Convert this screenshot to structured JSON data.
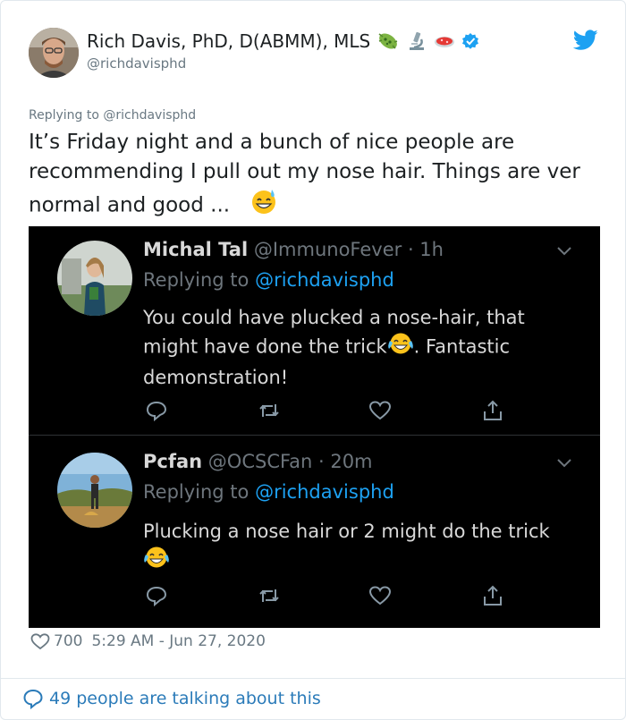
{
  "author": {
    "name": "Rich Davis, PhD, D(ABMM), MLS",
    "handle": "@richdavisphd"
  },
  "replying_to": "Replying to @richdavisphd",
  "tweet_text": "It’s Friday night and a bunch of nice people are recommending I pull out my nose hair. Things are ver normal and good ...",
  "embedded_replies": [
    {
      "name": "Michal Tal",
      "handle_time": "@ImmunoFever · 1h",
      "replying_prefix": "Replying to",
      "replying_handle": "@richdavisphd",
      "text_before_emoji": "You could have plucked a nose-hair, that might have done the trick",
      "text_after_emoji": ". Fantastic demonstration!"
    },
    {
      "name": "Pcfan",
      "handle_time": "@OCSCFan · 20m",
      "replying_prefix": "Replying to",
      "replying_handle": "@richdavisphd",
      "text_before_emoji": "Plucking a nose hair or 2 might do the trick",
      "text_after_emoji": ""
    }
  ],
  "stats": {
    "likes": "700",
    "timestamp": "5:29 AM - Jun 27, 2020"
  },
  "talking": "49 people are talking about this",
  "colors": {
    "twitter_blue": "#1da1f2",
    "link_blue": "#2b7bb9",
    "embed_background": "#000000",
    "muted_text": "#697882"
  },
  "icons": [
    "microbe-icon",
    "microscope-icon",
    "petri-dish-icon",
    "verified-badge-icon",
    "twitter-bird-icon",
    "reply-icon",
    "retweet-icon",
    "heart-icon",
    "share-icon",
    "chevron-down-icon",
    "speech-bubble-icon",
    "sweat-smile-emoji",
    "tears-of-joy-emoji"
  ]
}
